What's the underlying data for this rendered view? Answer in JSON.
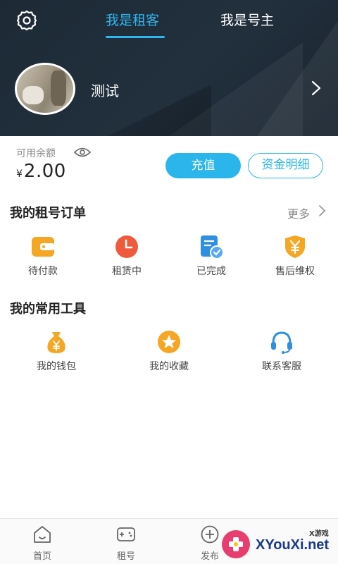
{
  "header": {
    "tabs": [
      {
        "label": "我是租客",
        "active": true
      },
      {
        "label": "我是号主",
        "active": false
      }
    ],
    "user": {
      "name": "测试"
    }
  },
  "wallet": {
    "balance_label": "可用余额",
    "currency": "¥",
    "balance": "2.00",
    "recharge_label": "充值",
    "detail_label": "资金明细"
  },
  "orders": {
    "title": "我的租号订单",
    "more_label": "更多",
    "items": [
      {
        "label": "待付款",
        "icon": "wallet-icon",
        "color": "#f5a623"
      },
      {
        "label": "租赁中",
        "icon": "clock-icon",
        "color": "#f05a3c"
      },
      {
        "label": "已完成",
        "icon": "completed-doc-icon",
        "color": "#2f8fe0"
      },
      {
        "label": "售后维权",
        "icon": "shield-yuan-icon",
        "color": "#f5a623"
      }
    ]
  },
  "tools": {
    "title": "我的常用工具",
    "items": [
      {
        "label": "我的钱包",
        "icon": "money-bag-icon",
        "color": "#f5a623"
      },
      {
        "label": "我的收藏",
        "icon": "star-icon",
        "color": "#f5a623"
      },
      {
        "label": "联系客服",
        "icon": "headset-icon",
        "color": "#2f8fe0"
      }
    ]
  },
  "bottom_nav": {
    "items": [
      {
        "label": "首页",
        "icon": "home-icon"
      },
      {
        "label": "租号",
        "icon": "gamepad-icon"
      },
      {
        "label": "发布",
        "icon": "plus-circle-icon"
      }
    ]
  },
  "watermark": {
    "small": "X游戏",
    "text": "XYouXi.net"
  },
  "colors": {
    "accent": "#2ab6ea",
    "header_bg": "#1d2a36"
  }
}
